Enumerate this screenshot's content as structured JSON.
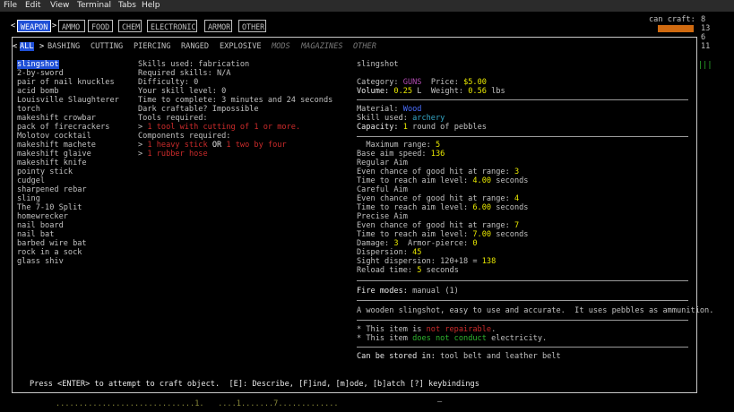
{
  "menubar": {
    "items": [
      "File",
      "Edit",
      "View",
      "Terminal",
      "Tabs",
      "Help"
    ]
  },
  "tabs": [
    "WEAPON",
    "AMMO",
    "FOOD",
    "CHEM",
    "ELECTRONIC",
    "ARMOR",
    "OTHER"
  ],
  "subtabs": [
    "ALL",
    "BASHING",
    "CUTTING",
    "PIERCING",
    "RANGED",
    "EXPLOSIVE",
    "MODS",
    "MAGAZINES",
    "OTHER"
  ],
  "can_craft": {
    "label": "can craft:",
    "nums": [
      "8",
      "13",
      "6",
      "11"
    ],
    "bars": "|||"
  },
  "items": [
    "slingshot",
    "2-by-sword",
    "pair of nail knuckles",
    "acid bomb",
    "Louisville Slaughterer",
    "torch",
    "makeshift crowbar",
    "pack of firecrackers",
    "Molotov cocktail",
    "makeshift machete",
    "makeshift glaive",
    "makeshift knife",
    "pointy stick",
    "cudgel",
    "sharpened rebar",
    "sling",
    "The 7-10 Split",
    "homewrecker",
    "nail board",
    "nail bat",
    "barbed wire bat",
    "rock in a sock",
    "glass shiv"
  ],
  "recipe": {
    "skills_used": "Skills used: fabrication",
    "required_skills": "Required skills: N/A",
    "difficulty": "Difficulty: 0",
    "skill_level": "Your skill level: 0",
    "time": "Time to complete: 3 minutes and 24 seconds",
    "dark": "Dark craftable? Impossible",
    "tools_hdr": "Tools required:",
    "tool1": "1 tool with cutting of 1 or more.",
    "comp_hdr": "Components required:",
    "comp1a": "1 heavy stick",
    "comp1or": "OR",
    "comp1b": "1 two by four",
    "comp2": "1 rubber hose",
    "gt": ">"
  },
  "info": {
    "name": "slingshot",
    "category_label": "Category:",
    "category": "GUNS",
    "price_label": "Price:",
    "price": "$5.00",
    "volume_label": "Volume:",
    "volume": "0.25",
    "volume_unit": "L",
    "weight_label": "Weight:",
    "weight": "0.56",
    "weight_unit": "lbs",
    "material_label": "Material:",
    "material": "Wood",
    "skill_label": "Skill used:",
    "skill": "archery",
    "capacity_label": "Capacity:",
    "capacity_n": "1",
    "capacity_rest": "round of pebbles",
    "max_range_label": "  Maximum range:",
    "max_range": "5",
    "aim_speed_label": "Base aim speed:",
    "aim_speed": "136",
    "regular": "Regular Aim",
    "careful": "Careful Aim",
    "precise": "Precise Aim",
    "even_label": "Even chance of good hit at range:",
    "time_label": "Time to reach aim level:",
    "seconds": "seconds",
    "reg_range": "3",
    "reg_time": "4.00",
    "car_range": "4",
    "car_time": "6.00",
    "pre_range": "7",
    "pre_time": "7.00",
    "damage_label": "Damage:",
    "damage": "3",
    "ap_label": "Armor-pierce:",
    "ap": "0",
    "dispersion_label": "Dispersion:",
    "dispersion": "45",
    "sight_label": "Sight dispersion: 120+18 =",
    "sight": "138",
    "reload_label": "Reload time:",
    "reload": "5",
    "reload_unit": "seconds",
    "fire_label": "Fire modes:",
    "fire": "manual (1)",
    "desc": "A wooden slingshot, easy to use and accurate.  It uses pebbles as ammunition.",
    "n1a": "* This item is",
    "n1b": "not repairable",
    "n1c": ".",
    "n2a": "* This item",
    "n2b": "does not conduct",
    "n2c": "electricity.",
    "stored_label": "Can be stored in:",
    "stored": "tool belt and leather belt"
  },
  "footer": "Press <ENTER> to attempt to craft object.  [E]: Describe, [F]ind, [m]ode, [b]atch [?] keybindings",
  "bottom_line": "..............................1.   ....1.......7.............",
  "colors": {
    "accent": "#1f4fd6",
    "orange": "#d06a10"
  }
}
